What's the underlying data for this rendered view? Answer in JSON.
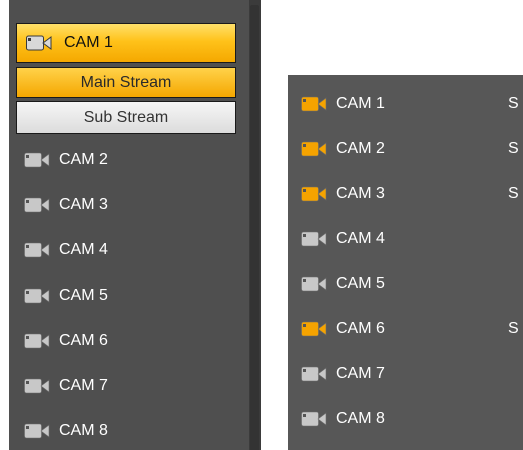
{
  "colors": {
    "panel_bg": "#4f4f4f",
    "active_icon": "#f5a300",
    "inactive_icon": "#c8c8c8",
    "selected_bg": "#ffc21a"
  },
  "left": {
    "selected_camera": {
      "label": "CAM 1",
      "icon": "camera-icon"
    },
    "streams": {
      "main": "Main Stream",
      "sub": "Sub Stream"
    },
    "cameras": [
      {
        "label": "CAM 2",
        "icon": "camera-icon"
      },
      {
        "label": "CAM 3",
        "icon": "camera-icon"
      },
      {
        "label": "CAM 4",
        "icon": "camera-icon"
      },
      {
        "label": "CAM 5",
        "icon": "camera-icon"
      },
      {
        "label": "CAM 6",
        "icon": "camera-icon"
      },
      {
        "label": "CAM 7",
        "icon": "camera-icon"
      },
      {
        "label": "CAM 8",
        "icon": "camera-icon"
      }
    ]
  },
  "right": {
    "cameras": [
      {
        "label": "CAM 1",
        "active": true,
        "status": "S"
      },
      {
        "label": "CAM 2",
        "active": true,
        "status": "S"
      },
      {
        "label": "CAM 3",
        "active": true,
        "status": "S"
      },
      {
        "label": "CAM 4",
        "active": false,
        "status": ""
      },
      {
        "label": "CAM 5",
        "active": false,
        "status": ""
      },
      {
        "label": "CAM 6",
        "active": true,
        "status": "S"
      },
      {
        "label": "CAM 7",
        "active": false,
        "status": ""
      },
      {
        "label": "CAM 8",
        "active": false,
        "status": ""
      }
    ]
  }
}
